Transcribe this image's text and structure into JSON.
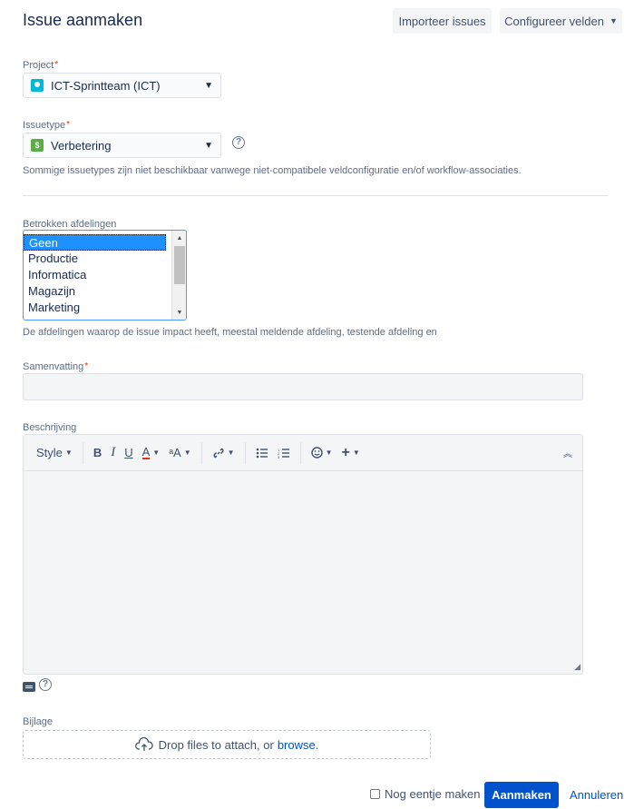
{
  "header": {
    "title": "Issue aanmaken",
    "import_button": "Importeer issues",
    "configure_button": "Configureer velden"
  },
  "project": {
    "label": "Project",
    "required_marker": "*",
    "value": "ICT-Sprintteam (ICT)",
    "icon": "project-avatar-icon"
  },
  "issuetype": {
    "label": "Issuetype",
    "required_marker": "*",
    "value": "Verbetering",
    "icon": "improvement-icon",
    "help_text": "Sommige issuetypes zijn niet beschikbaar vanwege niet-compatibele veldconfiguratie en/of workflow-associaties."
  },
  "departments": {
    "label": "Betrokken afdelingen",
    "options": [
      "Geen",
      "Productie",
      "Informatica",
      "Magazijn",
      "Marketing"
    ],
    "selected": "Geen",
    "description": "De afdelingen waarop de issue impact heeft, meestal meldende afdeling, testende afdeling en"
  },
  "summary": {
    "label": "Samenvatting",
    "required_marker": "*",
    "value": ""
  },
  "description": {
    "label": "Beschrijving",
    "toolbar": {
      "style_label": "Style",
      "bold": "B",
      "italic": "I",
      "underline": "U",
      "text_color": "A",
      "text_size": "ᵃA"
    },
    "value": ""
  },
  "attachment": {
    "label": "Bijlage",
    "drop_text": "Drop files to attach, or",
    "browse_link": "browse."
  },
  "footer": {
    "create_another": "Nog eentje maken",
    "create_button": "Aanmaken",
    "cancel_link": "Annuleren"
  },
  "colors": {
    "primary": "#0052cc",
    "required": "#de350b",
    "project_icon": "#00b8d9",
    "improvement_icon": "#5aac44"
  }
}
